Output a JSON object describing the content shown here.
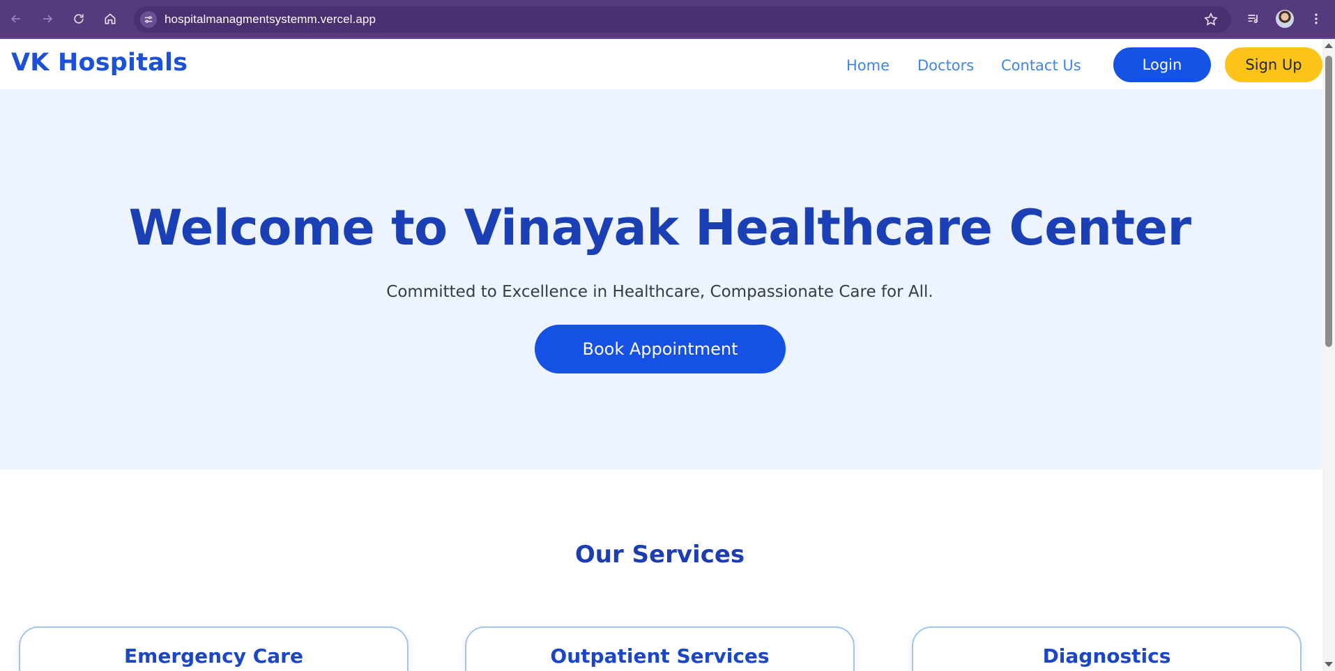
{
  "browser": {
    "url": "hospitalmanagmentsystemm.vercel.app",
    "icons": [
      "back-icon",
      "forward-icon",
      "reload-icon",
      "home-icon",
      "site-settings-icon",
      "bookmark-star-icon",
      "media-controls-icon",
      "profile-avatar",
      "menu-dots-icon"
    ]
  },
  "header": {
    "logo": "VK Hospitals",
    "nav": [
      {
        "label": "Home"
      },
      {
        "label": "Doctors"
      },
      {
        "label": "Contact Us"
      }
    ],
    "login_label": "Login",
    "signup_label": "Sign Up"
  },
  "hero": {
    "title": "Welcome to Vinayak Healthcare Center",
    "subtitle": "Committed to Excellence in Healthcare, Compassionate Care for All.",
    "cta_label": "Book Appointment"
  },
  "services": {
    "title": "Our Services",
    "cards": [
      {
        "title": "Emergency Care"
      },
      {
        "title": "Outpatient Services"
      },
      {
        "title": "Diagnostics"
      }
    ]
  },
  "colors": {
    "chrome": "#553a7e",
    "brand_blue": "#1c50d8",
    "link_blue": "#3f86e8",
    "heading_blue": "#1b40b5",
    "cta_blue": "#1551e5",
    "signup_yellow": "#fcc419",
    "hero_bg": "#edf4fd"
  }
}
